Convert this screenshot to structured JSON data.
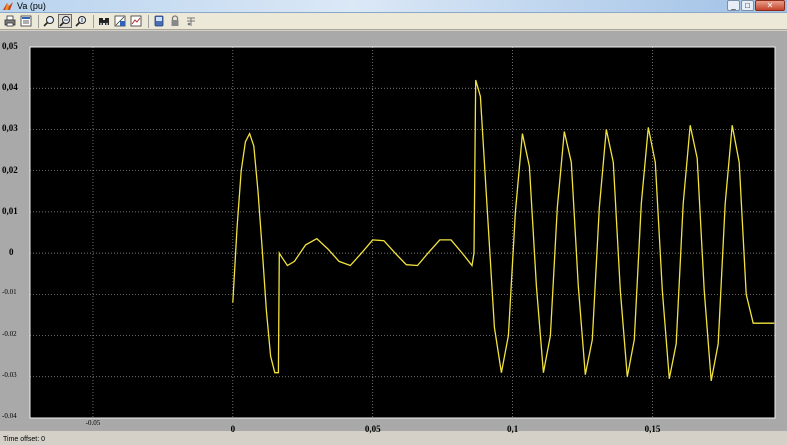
{
  "window": {
    "title": "Va (pu)",
    "minimize_symbol": "_",
    "maximize_symbol": "□",
    "close_symbol": "✕"
  },
  "toolbar": {
    "icons": [
      "print-icon",
      "parameters-icon",
      "zoom-icon",
      "zoom-x-icon",
      "zoom-y-icon",
      "autoscale-icon",
      "save-axes-icon",
      "restore-axes-icon",
      "floating-scope-icon",
      "lock-axes-icon",
      "signal-selection-icon"
    ]
  },
  "status": {
    "time_offset_label": "Time offset:",
    "time_offset_value": "0"
  },
  "chart_data": {
    "type": "line",
    "title": "",
    "xlabel": "",
    "ylabel": "",
    "xlim": [
      -0.0725,
      0.1938
    ],
    "ylim": [
      -0.04,
      0.05
    ],
    "yticks": [
      {
        "value": 0.05,
        "label": "0,05"
      },
      {
        "value": 0.04,
        "label": "0,04"
      },
      {
        "value": 0.03,
        "label": "0,03"
      },
      {
        "value": 0.02,
        "label": "0,02"
      },
      {
        "value": 0.01,
        "label": "0,01"
      },
      {
        "value": 0,
        "label": "0"
      },
      {
        "value": -0.01,
        "label": "-0.01"
      },
      {
        "value": -0.02,
        "label": "-0.02"
      },
      {
        "value": -0.03,
        "label": "-0.03"
      },
      {
        "value": -0.04,
        "label": "-0.04"
      }
    ],
    "xticks": [
      {
        "value": -0.05,
        "label": "-0.05"
      },
      {
        "value": 0,
        "label": "0"
      },
      {
        "value": 0.05,
        "label": "0,05"
      },
      {
        "value": 0.1,
        "label": "0,1"
      },
      {
        "value": 0.15,
        "label": "0,15"
      }
    ],
    "grid": true,
    "background": "#000000",
    "line_color": "#f2e33c",
    "series": [
      {
        "x": [
          0,
          0.0015,
          0.003,
          0.0045,
          0.006,
          0.0075,
          0.009,
          0.0105,
          0.012,
          0.0135,
          0.015,
          0.0163,
          0.0166,
          0.0175,
          0.0195,
          0.022,
          0.026,
          0.03,
          0.034,
          0.038,
          0.042,
          0.046,
          0.05,
          0.054,
          0.058,
          0.062,
          0.066,
          0.07,
          0.074,
          0.078,
          0.082,
          0.0855,
          0.0862,
          0.0868,
          0.0885,
          0.091,
          0.0935,
          0.096,
          0.0985,
          0.101,
          0.1035,
          0.106,
          0.1085,
          0.111,
          0.1135,
          0.116,
          0.1185,
          0.121,
          0.1235,
          0.126,
          0.1285,
          0.131,
          0.1335,
          0.136,
          0.1385,
          0.141,
          0.1435,
          0.146,
          0.1485,
          0.151,
          0.1535,
          0.156,
          0.1585,
          0.161,
          0.1635,
          0.166,
          0.1685,
          0.171,
          0.1735,
          0.176,
          0.1785,
          0.181,
          0.1835,
          0.186,
          0.1885,
          0.191,
          0.1935
        ],
        "y": [
          -0.012,
          0.006,
          0.02,
          0.027,
          0.029,
          0.026,
          0.015,
          0.001,
          -0.014,
          -0.025,
          -0.029,
          -0.029,
          0.0,
          -0.001,
          -0.003,
          -0.002,
          0.002,
          0.0035,
          0.001,
          -0.002,
          -0.003,
          0.0,
          0.0032,
          0.003,
          0.0,
          -0.0028,
          -0.003,
          0.0002,
          0.0032,
          0.0032,
          0.0,
          -0.003,
          0.0,
          0.042,
          0.038,
          0.01,
          -0.018,
          -0.029,
          -0.02,
          0.01,
          0.029,
          0.021,
          -0.008,
          -0.029,
          -0.02,
          0.011,
          0.0295,
          0.022,
          -0.008,
          -0.0295,
          -0.021,
          0.011,
          0.03,
          0.022,
          -0.009,
          -0.03,
          -0.021,
          0.012,
          0.0305,
          0.022,
          -0.009,
          -0.0305,
          -0.022,
          0.012,
          0.031,
          0.023,
          -0.009,
          -0.031,
          -0.022,
          0.012,
          0.031,
          0.022,
          -0.01,
          -0.017,
          -0.017,
          -0.017,
          -0.017
        ]
      }
    ]
  }
}
